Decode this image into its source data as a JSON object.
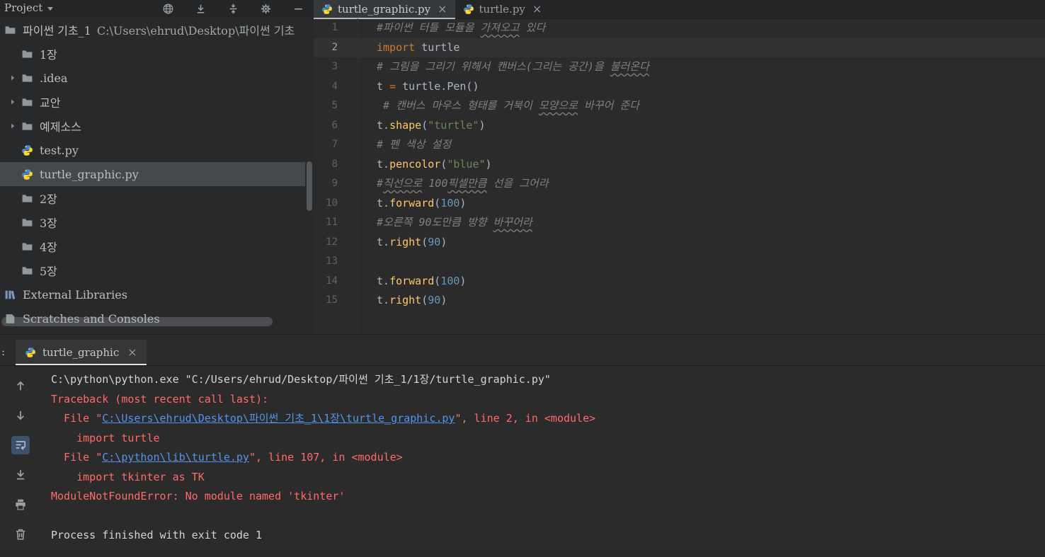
{
  "colors": {
    "editor_bg": "#2b2b2b",
    "panel_bg": "#27292b",
    "selection_bg": "#45494c",
    "current_line_bg": "#323233",
    "keyword": "#cc7832",
    "string": "#6a8759",
    "number": "#6897bb",
    "function": "#ffc66b",
    "comment": "#808080",
    "plain_text": "#a9b7c6",
    "error_red": "#ff6b68",
    "link_blue": "#5394ec"
  },
  "project_panel": {
    "title": "Project",
    "toolbar_icons": [
      "locate",
      "scroll-from-source",
      "collapse-all",
      "settings",
      "hide"
    ],
    "tree": [
      {
        "id": "root",
        "icon": "folder",
        "label": "파이썬 기초_1",
        "path": "C:\\Users\\ehrud\\Desktop\\파이썬 기초",
        "indent": 0,
        "arrow": false,
        "selected": false
      },
      {
        "id": "1jang",
        "icon": "folder",
        "label": "1장",
        "indent": 1,
        "arrow": false,
        "selected": false
      },
      {
        "id": "idea",
        "icon": "folder",
        "label": ".idea",
        "indent": 1,
        "arrow": true,
        "selected": false
      },
      {
        "id": "gyoan",
        "icon": "folder",
        "label": "교안",
        "indent": 1,
        "arrow": true,
        "selected": false
      },
      {
        "id": "yejesosu",
        "icon": "folder",
        "label": "예제소스",
        "indent": 1,
        "arrow": true,
        "selected": false
      },
      {
        "id": "test-py",
        "icon": "python",
        "label": "test.py",
        "indent": 1,
        "arrow": false,
        "selected": false
      },
      {
        "id": "turtle-graphic-py",
        "icon": "python",
        "label": "turtle_graphic.py",
        "indent": 1,
        "arrow": false,
        "selected": true
      },
      {
        "id": "2jang",
        "icon": "folder",
        "label": "2장",
        "indent": 1,
        "arrow": false,
        "selected": false
      },
      {
        "id": "3jang",
        "icon": "folder",
        "label": "3장",
        "indent": 1,
        "arrow": false,
        "selected": false
      },
      {
        "id": "4jang",
        "icon": "folder",
        "label": "4장",
        "indent": 1,
        "arrow": false,
        "selected": false
      },
      {
        "id": "5jang",
        "icon": "folder",
        "label": "5장",
        "indent": 1,
        "arrow": false,
        "selected": false
      },
      {
        "id": "external-libraries",
        "icon": "library",
        "label": "External Libraries",
        "indent": 0,
        "arrow": false,
        "selected": false
      },
      {
        "id": "scratches-and-consoles",
        "icon": "scratches",
        "label": "Scratches and Consoles",
        "indent": 0,
        "arrow": false,
        "selected": false
      }
    ]
  },
  "editor": {
    "tabs": [
      {
        "label": "turtle_graphic.py",
        "active": true
      },
      {
        "label": "turtle.py",
        "active": false
      }
    ],
    "lines": [
      {
        "n": "1",
        "tokens": [
          {
            "t": "#파이썬 터틀 모듈을 ",
            "c": "cm"
          },
          {
            "t": "가져오고",
            "c": "cmu"
          },
          {
            "t": " 있다",
            "c": "cm"
          }
        ]
      },
      {
        "n": "2",
        "current": true,
        "tokens": [
          {
            "t": "import",
            "c": "k"
          },
          {
            "t": " turtle",
            "c": "pl"
          }
        ]
      },
      {
        "n": "3",
        "tokens": [
          {
            "t": "# 그림을 그리기 위해서 캔버스(그리는 공간)을 ",
            "c": "cm"
          },
          {
            "t": "불러온다",
            "c": "cmu"
          }
        ]
      },
      {
        "n": "4",
        "tokens": [
          {
            "t": "t ",
            "c": "pl"
          },
          {
            "t": "=",
            "c": "k"
          },
          {
            "t": " turtle.Pen()",
            "c": "pl"
          }
        ]
      },
      {
        "n": "5",
        "tokens": [
          {
            "t": " # 캔버스 마우스 형태를 거북이 ",
            "c": "cm"
          },
          {
            "t": "모양으로",
            "c": "cmu"
          },
          {
            "t": " 바꾸어 준다",
            "c": "cm"
          }
        ]
      },
      {
        "n": "6",
        "tokens": [
          {
            "t": "t.",
            "c": "pl"
          },
          {
            "t": "shape",
            "c": "fn"
          },
          {
            "t": "(",
            "c": "pl"
          },
          {
            "t": "\"turtle\"",
            "c": "s"
          },
          {
            "t": ")",
            "c": "pl"
          }
        ]
      },
      {
        "n": "7",
        "tokens": [
          {
            "t": "# 펜 색상 설정",
            "c": "cm"
          }
        ]
      },
      {
        "n": "8",
        "tokens": [
          {
            "t": "t.",
            "c": "pl"
          },
          {
            "t": "pencolor",
            "c": "fn"
          },
          {
            "t": "(",
            "c": "pl"
          },
          {
            "t": "\"blue\"",
            "c": "s"
          },
          {
            "t": ")",
            "c": "pl"
          }
        ]
      },
      {
        "n": "9",
        "tokens": [
          {
            "t": "#",
            "c": "cm"
          },
          {
            "t": "직선으로",
            "c": "cmu"
          },
          {
            "t": " 100",
            "c": "cm"
          },
          {
            "t": "픽셀만큼",
            "c": "cmu"
          },
          {
            "t": " 선을 그어라",
            "c": "cm"
          }
        ]
      },
      {
        "n": "10",
        "tokens": [
          {
            "t": "t.",
            "c": "pl"
          },
          {
            "t": "forward",
            "c": "fn"
          },
          {
            "t": "(",
            "c": "pl"
          },
          {
            "t": "100",
            "c": "n"
          },
          {
            "t": ")",
            "c": "pl"
          }
        ]
      },
      {
        "n": "11",
        "tokens": [
          {
            "t": "#오른쪽 90도만큼 방향 ",
            "c": "cm"
          },
          {
            "t": "바꾸어라",
            "c": "cmu"
          }
        ]
      },
      {
        "n": "12",
        "tokens": [
          {
            "t": "t.",
            "c": "pl"
          },
          {
            "t": "right",
            "c": "fn"
          },
          {
            "t": "(",
            "c": "pl"
          },
          {
            "t": "90",
            "c": "n"
          },
          {
            "t": ")",
            "c": "pl"
          }
        ]
      },
      {
        "n": "13",
        "tokens": []
      },
      {
        "n": "14",
        "tokens": [
          {
            "t": "t.",
            "c": "pl"
          },
          {
            "t": "forward",
            "c": "fn"
          },
          {
            "t": "(",
            "c": "pl"
          },
          {
            "t": "100",
            "c": "n"
          },
          {
            "t": ")",
            "c": "pl"
          }
        ]
      },
      {
        "n": "15",
        "tokens": [
          {
            "t": "t.",
            "c": "pl"
          },
          {
            "t": "right",
            "c": "fn"
          },
          {
            "t": "(",
            "c": "pl"
          },
          {
            "t": "90",
            "c": "n"
          },
          {
            "t": ")",
            "c": "pl"
          }
        ]
      }
    ]
  },
  "run_panel": {
    "prefix": ":",
    "tab": {
      "label": "turtle_graphic"
    },
    "toolbar_icons": [
      {
        "name": "up-stack-trace",
        "selected": false
      },
      {
        "name": "down-stack-trace",
        "selected": false
      },
      {
        "name": "soft-wrap",
        "selected": true
      },
      {
        "name": "scroll-to-end",
        "selected": false
      },
      {
        "name": "print",
        "selected": false
      },
      {
        "name": "clear-all",
        "selected": false
      }
    ],
    "console": [
      {
        "tokens": [
          {
            "t": "C:\\python\\python.exe \"C:/Users/ehrud/Desktop/파이썬 기초_1/1장/turtle_graphic.py\"",
            "c": "out"
          }
        ]
      },
      {
        "tokens": [
          {
            "t": "Traceback (most recent call last):",
            "c": "err"
          }
        ]
      },
      {
        "tokens": [
          {
            "t": "  File \"",
            "c": "err"
          },
          {
            "t": "C:\\Users\\ehrud\\Desktop\\파이썬 기초_1\\1장\\turtle_graphic.py",
            "c": "link"
          },
          {
            "t": "\", line 2, in <module>",
            "c": "err"
          }
        ]
      },
      {
        "tokens": [
          {
            "t": "    import turtle",
            "c": "err"
          }
        ]
      },
      {
        "tokens": [
          {
            "t": "  File \"",
            "c": "err"
          },
          {
            "t": "C:\\python\\lib\\turtle.py",
            "c": "link"
          },
          {
            "t": "\", line 107, in <module>",
            "c": "err"
          }
        ]
      },
      {
        "tokens": [
          {
            "t": "    import tkinter as TK",
            "c": "err"
          }
        ]
      },
      {
        "tokens": [
          {
            "t": "ModuleNotFoundError: No module named 'tkinter'",
            "c": "err"
          }
        ]
      },
      {
        "tokens": []
      },
      {
        "tokens": [
          {
            "t": "Process finished with exit code 1",
            "c": "out"
          }
        ]
      }
    ]
  }
}
